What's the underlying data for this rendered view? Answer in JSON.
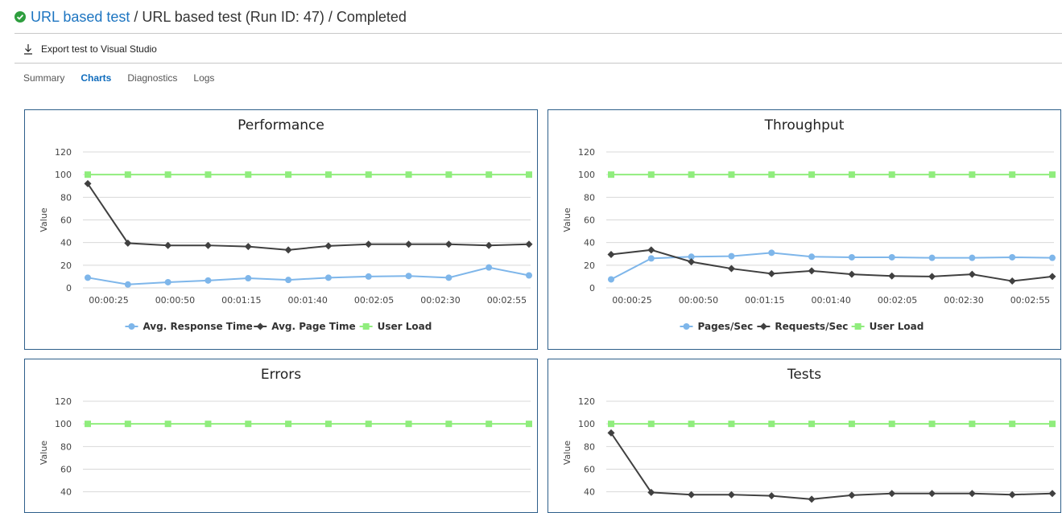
{
  "header": {
    "status_icon": "check-circle-icon",
    "status_color": "#2e9e3e",
    "test_name": "URL based test",
    "trail": " / URL based test (Run ID: 47) / Completed"
  },
  "toolbar": {
    "export_icon": "download-icon",
    "export_label": "Export test to Visual Studio"
  },
  "tabs": [
    {
      "label": "Summary",
      "active": false
    },
    {
      "label": "Charts",
      "active": true
    },
    {
      "label": "Diagnostics",
      "active": false
    },
    {
      "label": "Logs",
      "active": false
    }
  ],
  "colors": {
    "series_light_blue": "#7eb6ea",
    "series_dark": "#404040",
    "series_green": "#90ed7d",
    "link": "#1d75c1",
    "panel_border": "#2e5f8a"
  },
  "chart_data": [
    {
      "type": "line",
      "title": "Performance",
      "ylabel": "Value",
      "ylim": [
        0,
        120
      ],
      "yticks": [
        0,
        20,
        40,
        60,
        80,
        100,
        120
      ],
      "x_tick_labels": [
        "00:00:25",
        "00:00:50",
        "00:01:15",
        "00:01:40",
        "00:02:05",
        "00:02:30",
        "00:02:55"
      ],
      "grid": true,
      "legend_position": "bottom-center",
      "series": [
        {
          "name": "Avg. Response Time",
          "color": "#7eb6ea",
          "marker": "circle",
          "values": [
            9,
            3,
            5,
            6.5,
            8.5,
            7,
            9,
            10,
            10.5,
            9,
            18,
            11
          ]
        },
        {
          "name": "Avg. Page Time",
          "color": "#404040",
          "marker": "diamond",
          "values": [
            92,
            39.5,
            37.5,
            37.5,
            36.5,
            33.5,
            37,
            38.5,
            38.5,
            38.5,
            37.5,
            38.5
          ]
        },
        {
          "name": "User Load",
          "color": "#90ed7d",
          "marker": "square",
          "values": [
            100,
            100,
            100,
            100,
            100,
            100,
            100,
            100,
            100,
            100,
            100,
            100
          ]
        }
      ]
    },
    {
      "type": "line",
      "title": "Throughput",
      "ylabel": "Value",
      "ylim": [
        0,
        120
      ],
      "yticks": [
        0,
        20,
        40,
        60,
        80,
        100,
        120
      ],
      "x_tick_labels": [
        "00:00:25",
        "00:00:50",
        "00:01:15",
        "00:01:40",
        "00:02:05",
        "00:02:30",
        "00:02:55"
      ],
      "grid": true,
      "legend_position": "bottom-center",
      "series": [
        {
          "name": "Pages/Sec",
          "color": "#7eb6ea",
          "marker": "circle",
          "values": [
            7.5,
            26,
            27.5,
            28,
            31,
            27.5,
            27,
            27,
            26.5,
            26.5,
            27,
            26.5
          ]
        },
        {
          "name": "Requests/Sec",
          "color": "#404040",
          "marker": "diamond",
          "values": [
            29.5,
            33.5,
            23,
            17,
            12.5,
            15,
            12,
            10.5,
            10,
            12,
            6,
            10
          ]
        },
        {
          "name": "User Load",
          "color": "#90ed7d",
          "marker": "square",
          "values": [
            100,
            100,
            100,
            100,
            100,
            100,
            100,
            100,
            100,
            100,
            100,
            100
          ]
        }
      ]
    },
    {
      "type": "line",
      "title": "Errors",
      "ylabel": "Value",
      "ylim": [
        0,
        120
      ],
      "yticks": [
        40,
        60,
        80,
        100,
        120
      ],
      "x_tick_labels": [],
      "grid": true,
      "legend_position": "",
      "series": [
        {
          "name": "",
          "color": "#90ed7d",
          "marker": "square",
          "values": [
            100,
            100,
            100,
            100,
            100,
            100,
            100,
            100,
            100,
            100,
            100,
            100
          ]
        }
      ]
    },
    {
      "type": "line",
      "title": "Tests",
      "ylabel": "Value",
      "ylim": [
        0,
        120
      ],
      "yticks": [
        40,
        60,
        80,
        100,
        120
      ],
      "x_tick_labels": [],
      "grid": true,
      "legend_position": "",
      "series": [
        {
          "name": "",
          "color": "#404040",
          "marker": "diamond",
          "values": [
            92,
            39.5,
            37.5,
            37.5,
            36.5,
            33.5,
            37,
            38.5,
            38.5,
            38.5,
            37.5,
            38.5
          ]
        },
        {
          "name": "",
          "color": "#90ed7d",
          "marker": "square",
          "values": [
            100,
            100,
            100,
            100,
            100,
            100,
            100,
            100,
            100,
            100,
            100,
            100
          ]
        }
      ]
    }
  ]
}
